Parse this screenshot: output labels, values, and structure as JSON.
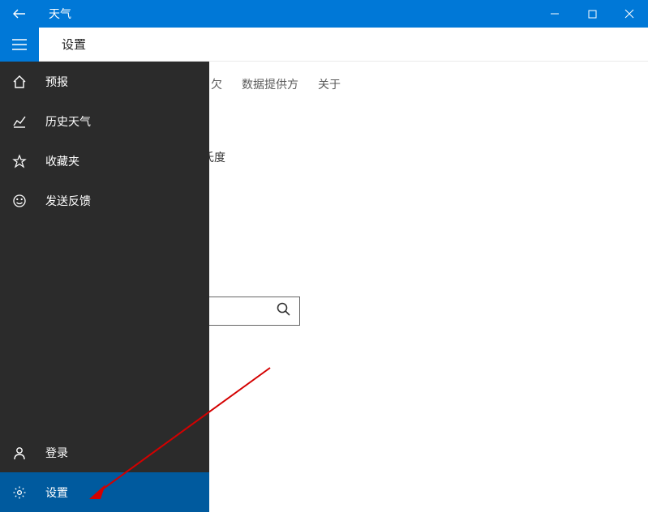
{
  "titlebar": {
    "app_name": "天气"
  },
  "subheader": {
    "page_title": "设置"
  },
  "tabs": {
    "t1_suffix": "欠",
    "t2": "数据提供方",
    "t3": "关于"
  },
  "content": {
    "partial_text": "氏度"
  },
  "sidebar": {
    "forecast": "预报",
    "history": "历史天气",
    "favorites": "收藏夹",
    "feedback": "发送反馈",
    "signin": "登录",
    "settings": "设置"
  }
}
